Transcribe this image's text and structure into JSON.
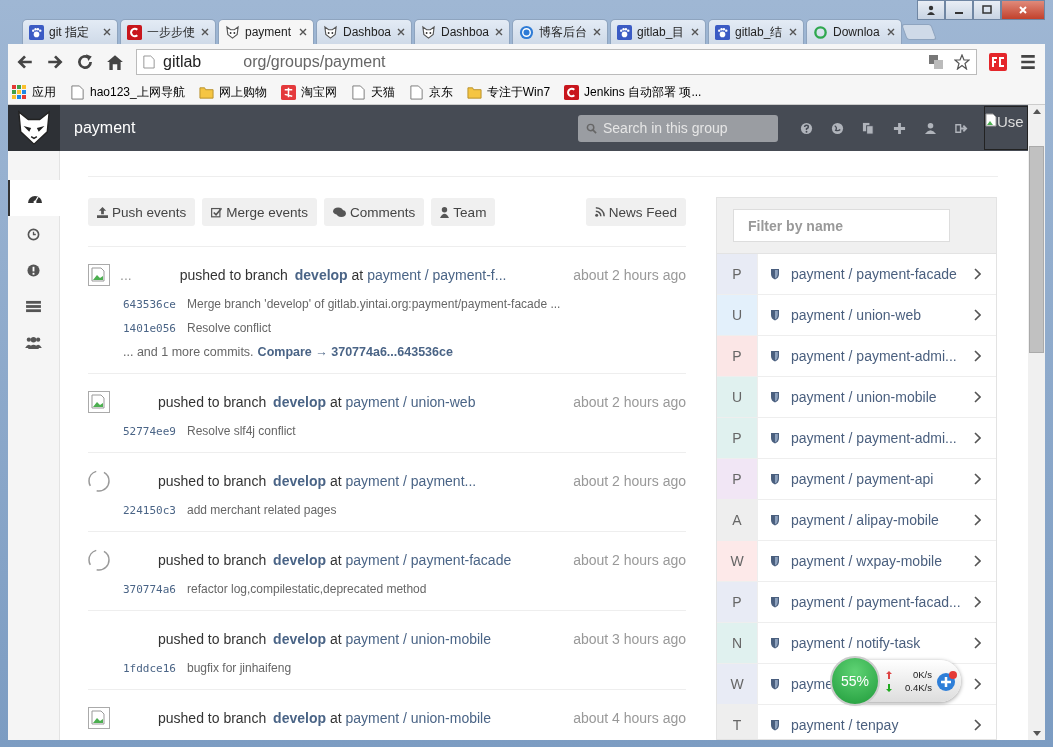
{
  "browser": {
    "tabs": [
      {
        "label": "git 指定",
        "selected": false
      },
      {
        "label": "一步步使",
        "selected": false
      },
      {
        "label": "payment",
        "selected": true
      },
      {
        "label": "Dashboa",
        "selected": false
      },
      {
        "label": "Dashboa",
        "selected": false
      },
      {
        "label": "博客后台",
        "selected": false
      },
      {
        "label": "gitlab_目",
        "selected": false
      },
      {
        "label": "gitlab_结",
        "selected": false
      },
      {
        "label": "Downloa",
        "selected": false
      }
    ],
    "address": {
      "host": "gitlab",
      "path": "org/groups/payment"
    },
    "bookmarks": [
      "应用",
      "hao123_上网导航",
      "网上购物",
      "淘宝网",
      "天猫",
      "京东",
      "专注于Win7",
      "Jenkins 自动部署 项..."
    ]
  },
  "header": {
    "title": "payment",
    "search": {
      "placeholder": "Search in this group"
    },
    "avatar_alt": "Use"
  },
  "sidebar": {
    "items": [
      {
        "selected": true
      },
      {
        "selected": false
      },
      {
        "selected": false
      },
      {
        "selected": false
      },
      {
        "selected": false
      }
    ]
  },
  "filters": [
    "Push events",
    "Merge events",
    "Comments",
    "Team"
  ],
  "news_feed": "News Feed",
  "events": [
    {
      "author": "...",
      "action": "pushed to branch",
      "branch": "develop",
      "at": "at",
      "project": "payment / payment-f...",
      "time": "about 2 hours ago",
      "commits": [
        {
          "sha": "643536ce",
          "message": "Merge branch 'develop' of gitlab.yintai.org:payment/payment-facade ..."
        },
        {
          "sha": "1401e056",
          "message": "Resolve conflict"
        }
      ],
      "more": {
        "text": "... and 1 more commits.",
        "link": "Compare → 370774a6...643536ce"
      }
    },
    {
      "action": "pushed to branch",
      "branch": "develop",
      "at": "at",
      "project": "payment / union-web",
      "time": "about 2 hours ago",
      "commits": [
        {
          "sha": "52774ee9",
          "message": "Resolve slf4j conflict"
        }
      ]
    },
    {
      "action": "pushed to branch",
      "branch": "develop",
      "at": "at",
      "project": "payment / payment...",
      "time": "about 2 hours ago",
      "commits": [
        {
          "sha": "224150c3",
          "message": "add merchant related pages"
        }
      ]
    },
    {
      "action": "pushed to branch",
      "branch": "develop",
      "at": "at",
      "project": "payment / payment-facade",
      "time": "about 2 hours ago",
      "commits": [
        {
          "sha": "370774a6",
          "message": "refactor log,compilestatic,deprecated method"
        }
      ]
    },
    {
      "action": "pushed to branch",
      "branch": "develop",
      "at": "at",
      "project": "payment / union-mobile",
      "time": "about 3 hours ago",
      "commits": [
        {
          "sha": "1fddce16",
          "message": "bugfix for jinhaifeng"
        }
      ]
    },
    {
      "action": "pushed to branch",
      "branch": "develop",
      "at": "at",
      "project": "payment / union-mobile",
      "time": "about 4 hours ago"
    }
  ],
  "projects": {
    "filter_placeholder": "Filter by name",
    "items": [
      {
        "letter": "P",
        "color": "#e8ebf5",
        "name": "payment / payment-facade"
      },
      {
        "letter": "U",
        "color": "#e3f0fb",
        "name": "payment / union-web"
      },
      {
        "letter": "P",
        "color": "#fbe6e6",
        "name": "payment / payment-admi..."
      },
      {
        "letter": "U",
        "color": "#e0f1ef",
        "name": "payment / union-mobile"
      },
      {
        "letter": "P",
        "color": "#e0f1ef",
        "name": "payment / payment-admi..."
      },
      {
        "letter": "P",
        "color": "#f1e6f5",
        "name": "payment / payment-api"
      },
      {
        "letter": "A",
        "color": "#eeeeee",
        "name": "payment / alipay-mobile"
      },
      {
        "letter": "W",
        "color": "#fde9e9",
        "name": "payment / wxpay-mobile"
      },
      {
        "letter": "P",
        "color": "#e8ebf5",
        "name": "payment / payment-facad..."
      },
      {
        "letter": "N",
        "color": "#e0f1ef",
        "name": "payment / notify-task"
      },
      {
        "letter": "W",
        "color": "#e8ebf5",
        "name": "payme"
      },
      {
        "letter": "T",
        "color": "#eeeeee",
        "name": "payment / tenpay"
      }
    ]
  },
  "speed_widget": {
    "percent": "55%",
    "up": "0K/s",
    "down": "0.4K/s"
  }
}
